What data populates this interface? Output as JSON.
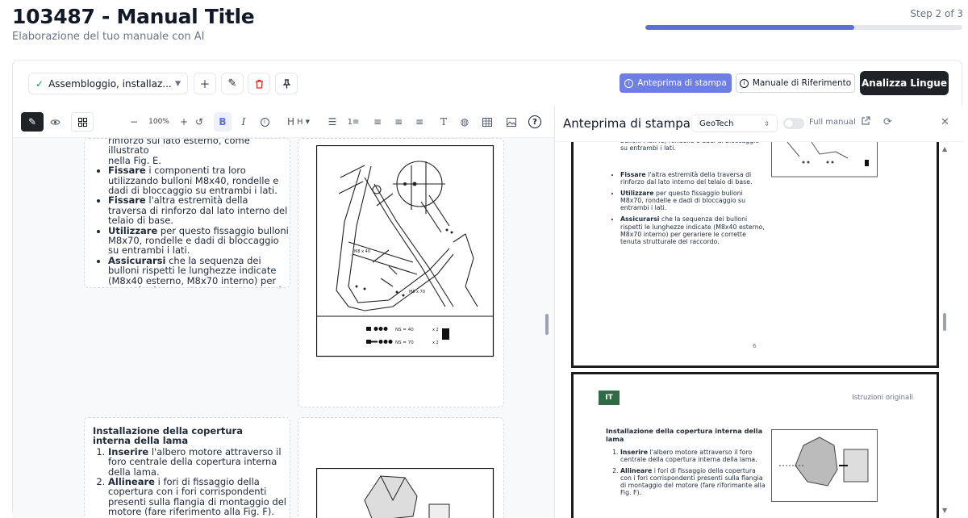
{
  "header": {
    "title": "103487 - Manual Title",
    "subtitle": "Elaborazione del tuo manuale con AI",
    "step": "Step 2 of 3",
    "progress": 0.66
  },
  "topbar": {
    "section_select": "Assembloggio, installaz...",
    "anteprima_button": "Anteprima di stampa",
    "reference_button": "Manuale di Riferimento",
    "analyze_button": "Analizza Lingue"
  },
  "editor_toolbar": {
    "zoom": "100%",
    "heading": "H"
  },
  "editor": {
    "block1": {
      "cont1": "rinforzo sul lato esterno, come illustrato",
      "cont2": "nella Fig. E.",
      "items": [
        {
          "bold": "Fissare",
          "text": " i componenti tra loro utilizzando bulloni M8x40, rondelle e dadi di bloccaggio su entrambi i lati."
        },
        {
          "bold": "Fissare",
          "text": " l'altra estremità della traversa di rinforzo dal lato interno del telaio di base."
        },
        {
          "bold": "Utilizzare",
          "text": " per questo fissaggio bulloni M8x70, rondelle e dadi di bloccaggio su entrambi i lati."
        },
        {
          "bold": "Assicurarsi",
          "text": " che la sequenza dei bulloni rispetti le lunghezze indicate (M8x40 esterno, M8x70 interno) per garantire la corretta tenuta strutturale del raccordo."
        }
      ]
    },
    "block2": {
      "heading": "Installazione della copertura interna della lama",
      "items": [
        {
          "bold": "Inserire",
          "text": " l'albero motore attraverso il foro centrale della copertura interna della lama."
        },
        {
          "bold": "Allineare",
          "text": " i fori di fissaggio della copertura con i fori corrispondenti presenti sulla flangia di montaggio del motore (fare riferimento alla Fig. F)."
        }
      ]
    },
    "figure_labels": {
      "ns40": "NS = 40",
      "ns70": "NS = 70",
      "m8x40": "M8 x 40",
      "m8x70": "M8 x 70",
      "count2a": "x 2",
      "count2b": "x 2"
    }
  },
  "preview_panel": {
    "title": "Anteprima di stampa",
    "brand_select": "GeoTech",
    "full_manual_label": "Full manual",
    "full_manual_on": false
  },
  "preview_page1": {
    "top_fragment": "bulloni M8x40, rondelle e dadi di bloccaggio su entrambi i lati.",
    "items": [
      {
        "bold": "Fissare",
        "text": " l'altra estremità della traversa di rinforzo dal lato interno del telaio di base."
      },
      {
        "bold": "Utilizzare",
        "text": " per questo fissaggio bulloni M8x70, rondelle e dadi di bloccaggio su entrambi i lati."
      },
      {
        "bold": "Assicurarsi",
        "text": " che la sequenza dei bulloni rispetti le lunghezze indicate (M8x40 esterno, M8x70 interno) per gerariere le corrette tenuta strutturale dei raccordo."
      }
    ],
    "page_number": "6"
  },
  "preview_page2": {
    "lang_badge": "IT",
    "subtitle": "Istruzioni originali",
    "heading": "Installazione della copertura interna della lama",
    "items": [
      {
        "bold": "Inserire",
        "text": " l'albero motore attraverso il foro centrale della copertura interna della lama."
      },
      {
        "bold": "Allineare",
        "text": " i fori di fissaggio della copertura con i fori corrispondenti presenti sulla flangia di montaggio del motore (fare riforimante alla Fig. F)."
      }
    ]
  },
  "colors": {
    "accent": "#5b6fd6",
    "dark_button": "#1f2227",
    "badge_green": "#2f6b46"
  }
}
